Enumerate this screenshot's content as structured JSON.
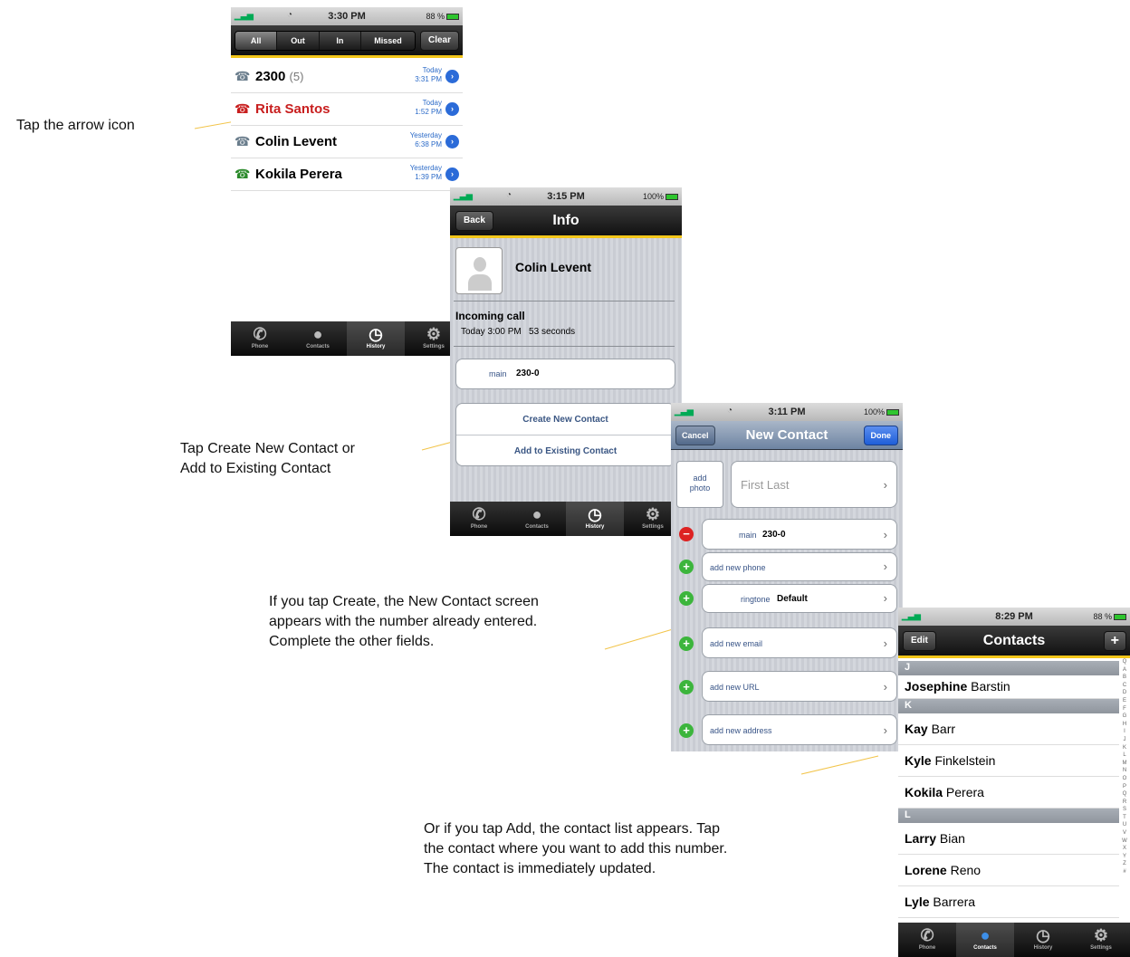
{
  "callouts": {
    "arrow": "Tap the arrow icon",
    "create_line1": "Tap Create New Contact or",
    "create_line2": "Add to Existing Contact",
    "newcontact_line1": "If you tap Create, the New Contact screen",
    "newcontact_line2": "appears with the number already entered.",
    "newcontact_line3": "Complete the other fields.",
    "add_line1": "Or if you tap Add, the contact list appears. Tap",
    "add_line2": "the contact where you want to add this number.",
    "add_line3": "The contact is immediately updated."
  },
  "colors": {
    "accent_yellow": "#f3c61a",
    "link_blue": "#2c6bc8",
    "missed_red": "#c81e1e",
    "callout_line": "#f2c44a"
  },
  "screen1": {
    "status": {
      "time": "3:30 PM",
      "battery": "88 %"
    },
    "segments": [
      "All",
      "Out",
      "In",
      "Missed"
    ],
    "clear": "Clear",
    "calls": [
      {
        "name": "2300",
        "count": "(5)",
        "day": "Today",
        "time": "3:31 PM",
        "missed": false
      },
      {
        "name": "Rita Santos",
        "count": "",
        "day": "Today",
        "time": "1:52 PM",
        "missed": true
      },
      {
        "name": "Colin Levent",
        "count": "",
        "day": "Yesterday",
        "time": "6:38 PM",
        "missed": false
      },
      {
        "name": "Kokila Perera",
        "count": "",
        "day": "Yesterday",
        "time": "1:39 PM",
        "missed": false
      }
    ],
    "tabs": [
      "Phone",
      "Contacts",
      "History",
      "Settings"
    ]
  },
  "screen2": {
    "status": {
      "time": "3:15 PM",
      "battery": "100%"
    },
    "back": "Back",
    "title": "Info",
    "contact_name": "Colin Levent",
    "call_type": "Incoming call",
    "call_detail": "Today 3:00 PM   53 seconds",
    "phone_label": "main",
    "phone_value": "230-0",
    "create_btn": "Create New Contact",
    "add_btn": "Add to Existing Contact",
    "tabs": [
      "Phone",
      "Contacts",
      "History",
      "Settings"
    ]
  },
  "screen3": {
    "status": {
      "time": "3:11 PM",
      "battery": "100%"
    },
    "cancel": "Cancel",
    "title": "New Contact",
    "done": "Done",
    "add_photo_1": "add",
    "add_photo_2": "photo",
    "name_placeholder": "First Last",
    "phone_label": "main",
    "phone_value": "230-0",
    "add_phone": "add new phone",
    "ringtone_label": "ringtone",
    "ringtone_value": "Default",
    "add_email": "add new email",
    "add_url": "add new URL",
    "add_address": "add new address"
  },
  "screen4": {
    "status": {
      "time": "8:29 PM",
      "battery": "88 %"
    },
    "edit": "Edit",
    "title": "Contacts",
    "add": "+",
    "sections": [
      {
        "letter": "J",
        "rows": [
          {
            "first": "Josephine",
            "last": "Barstin"
          }
        ]
      },
      {
        "letter": "K",
        "rows": [
          {
            "first": "Kay",
            "last": "Barr"
          },
          {
            "first": "Kyle",
            "last": "Finkelstein"
          },
          {
            "first": "Kokila",
            "last": "Perera"
          }
        ]
      },
      {
        "letter": "L",
        "rows": [
          {
            "first": "Larry",
            "last": "Bian"
          },
          {
            "first": "Lorene",
            "last": "Reno"
          },
          {
            "first": "Lyle",
            "last": "Barrera"
          }
        ]
      }
    ],
    "index": [
      "Q",
      "A",
      "B",
      "C",
      "D",
      "E",
      "F",
      "G",
      "H",
      "I",
      "J",
      "K",
      "L",
      "M",
      "N",
      "O",
      "P",
      "Q",
      "R",
      "S",
      "T",
      "U",
      "V",
      "W",
      "X",
      "Y",
      "Z",
      "#"
    ],
    "tabs": [
      "Phone",
      "Contacts",
      "History",
      "Settings"
    ]
  }
}
